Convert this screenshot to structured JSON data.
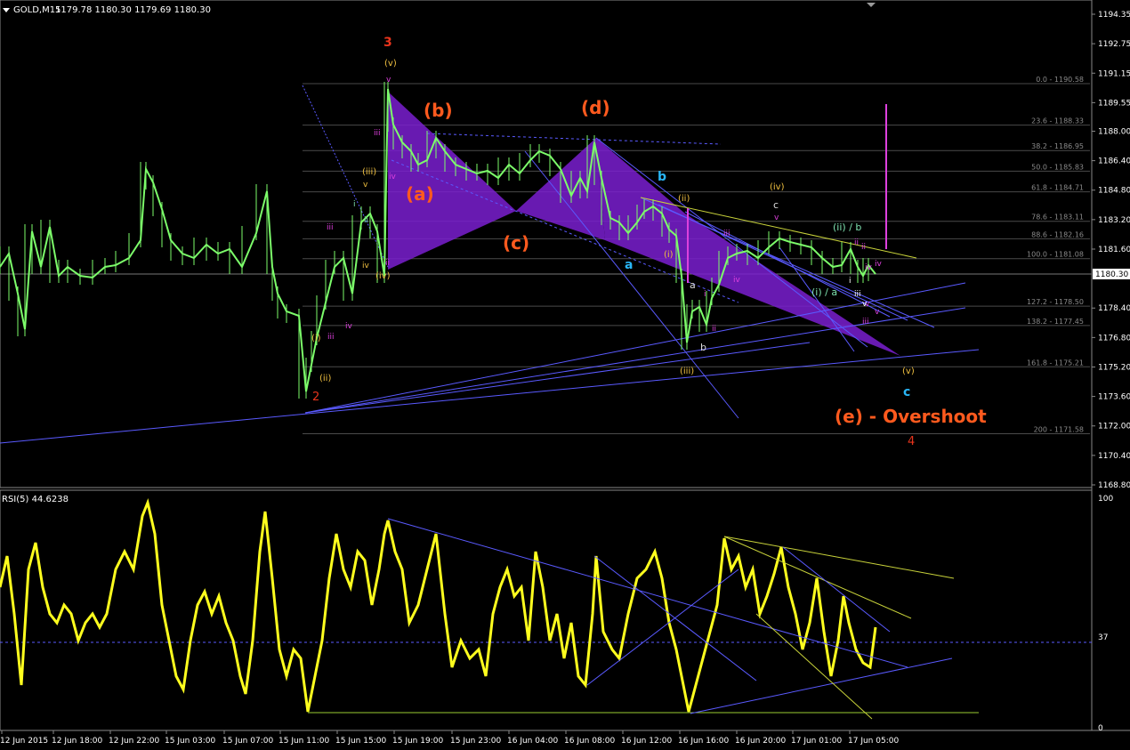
{
  "main_chart": {
    "title": "GOLD,M15",
    "ohlc": "1179.78 1180.30 1179.69 1180.30",
    "last_price": "1180.30",
    "price_axis": [
      {
        "label": "1194.35",
        "value": 1194.35
      },
      {
        "label": "1192.75",
        "value": 1192.75
      },
      {
        "label": "1191.15",
        "value": 1191.15
      },
      {
        "label": "1189.55",
        "value": 1189.55
      },
      {
        "label": "1188.00",
        "value": 1188.0
      },
      {
        "label": "1186.40",
        "value": 1186.4
      },
      {
        "label": "1184.80",
        "value": 1184.8
      },
      {
        "label": "1183.20",
        "value": 1183.2
      },
      {
        "label": "1181.60",
        "value": 1181.6
      },
      {
        "label": "1178.40",
        "value": 1178.4
      },
      {
        "label": "1176.80",
        "value": 1176.8
      },
      {
        "label": "1175.20",
        "value": 1175.2
      },
      {
        "label": "1173.60",
        "value": 1173.6
      },
      {
        "label": "1172.00",
        "value": 1172.0
      },
      {
        "label": "1170.40",
        "value": 1170.4
      },
      {
        "label": "1168.80",
        "value": 1168.8
      }
    ],
    "fib_levels": [
      {
        "label": "0.0 - 1190.58",
        "value": 1190.58
      },
      {
        "label": "23.6 - 1188.33",
        "value": 1188.33
      },
      {
        "label": "38.2 - 1186.95",
        "value": 1186.95
      },
      {
        "label": "50.0 - 1185.83",
        "value": 1185.83
      },
      {
        "label": "61.8 - 1184.71",
        "value": 1184.71
      },
      {
        "label": "78.6 - 1183.11",
        "value": 1183.11
      },
      {
        "label": "88.6 - 1182.16",
        "value": 1182.16
      },
      {
        "label": "100.0 - 1181.08",
        "value": 1181.08
      },
      {
        "label": "127.2 - 1178.50",
        "value": 1178.5
      },
      {
        "label": "138.2 - 1177.45",
        "value": 1177.45
      },
      {
        "label": "161.8 - 1175.21",
        "value": 1175.21
      },
      {
        "label": "200 - 1171.58",
        "value": 1171.58
      }
    ],
    "wave_labels": [
      {
        "text": "3",
        "color": "#e8341c"
      },
      {
        "text": "2",
        "color": "#e8341c"
      },
      {
        "text": "4",
        "color": "#e8341c"
      },
      {
        "text": "(v)",
        "color": "#f0c040"
      },
      {
        "text": "(iii)",
        "color": "#f0c040"
      },
      {
        "text": "(iv)",
        "color": "#f0c040"
      },
      {
        "text": "(i)",
        "color": "#f0c040"
      },
      {
        "text": "(ii)",
        "color": "#f0c040"
      },
      {
        "text": "(a)",
        "color": "#ff5a1e"
      },
      {
        "text": "(b)",
        "color": "#ff5a1e"
      },
      {
        "text": "(c)",
        "color": "#ff5a1e"
      },
      {
        "text": "(d)",
        "color": "#ff5a1e"
      },
      {
        "text": "(e) - Overshoot",
        "color": "#ff5a1e"
      },
      {
        "text": "a",
        "color": "#29b6f6"
      },
      {
        "text": "b",
        "color": "#29b6f6"
      },
      {
        "text": "c",
        "color": "#29b6f6"
      },
      {
        "text": "(ii)",
        "color": "#f0c040"
      },
      {
        "text": "(i)",
        "color": "#f0c040"
      },
      {
        "text": "(iii)",
        "color": "#f0c040"
      },
      {
        "text": "(iv)",
        "color": "#f0c040"
      },
      {
        "text": "(v)",
        "color": "#f0c040"
      },
      {
        "text": "(ii) / b",
        "color": "#7fe3b0"
      },
      {
        "text": "(i) / a",
        "color": "#7fe3b0"
      },
      {
        "text": "c",
        "color": "#dddddd"
      },
      {
        "text": "a",
        "color": "#dddddd"
      },
      {
        "text": "b",
        "color": "#dddddd"
      }
    ],
    "small_labels": [
      "v",
      "iii",
      "iv",
      "ii",
      "iii",
      "v",
      "iv",
      "ii",
      "i",
      "iii",
      "iv",
      "iv",
      "v",
      "iii",
      "ii",
      "i",
      "ii",
      "iv",
      "i",
      "iii",
      "v",
      "iii",
      "v",
      "ii",
      "iv",
      "v"
    ]
  },
  "rsi_panel": {
    "title": "RSI(5) 44.6238",
    "levels": [
      {
        "label": "100",
        "value": 100
      },
      {
        "label": "37",
        "value": 37
      },
      {
        "label": "0",
        "value": 0
      }
    ]
  },
  "time_axis": [
    "12 Jun 2015",
    "12 Jun 18:00",
    "12 Jun 22:00",
    "15 Jun 03:00",
    "15 Jun 07:00",
    "15 Jun 11:00",
    "15 Jun 15:00",
    "15 Jun 19:00",
    "15 Jun 23:00",
    "16 Jun 04:00",
    "16 Jun 08:00",
    "16 Jun 12:00",
    "16 Jun 16:00",
    "16 Jun 20:00",
    "17 Jun 01:00",
    "17 Jun 05:00"
  ],
  "colors": {
    "background": "#000000",
    "candles": "#7cfc6a",
    "rsi_line": "#ffff1e",
    "trendline": "#5a5aff",
    "triangle_fill": "#7a1fd0",
    "magenta": "#dd40dd"
  }
}
